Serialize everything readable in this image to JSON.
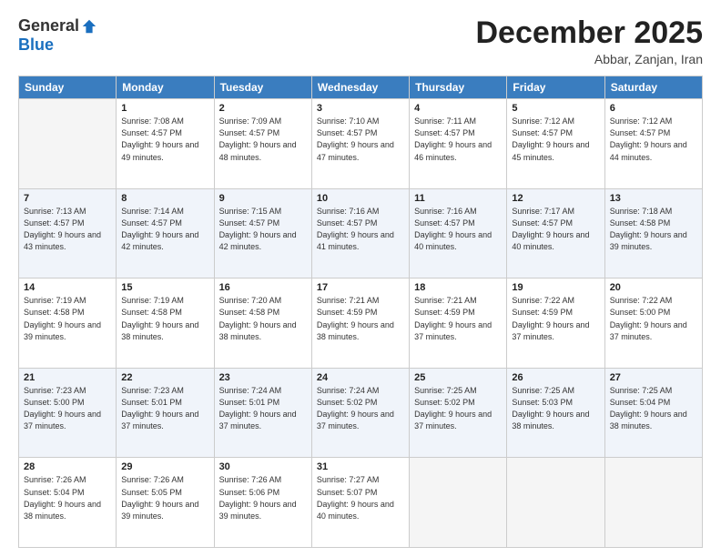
{
  "logo": {
    "general": "General",
    "blue": "Blue"
  },
  "title": "December 2025",
  "subtitle": "Abbar, Zanjan, Iran",
  "weekdays": [
    "Sunday",
    "Monday",
    "Tuesday",
    "Wednesday",
    "Thursday",
    "Friday",
    "Saturday"
  ],
  "weeks": [
    [
      {
        "day": "",
        "empty": true
      },
      {
        "day": "1",
        "sunrise": "7:08 AM",
        "sunset": "4:57 PM",
        "daylight": "9 hours and 49 minutes."
      },
      {
        "day": "2",
        "sunrise": "7:09 AM",
        "sunset": "4:57 PM",
        "daylight": "9 hours and 48 minutes."
      },
      {
        "day": "3",
        "sunrise": "7:10 AM",
        "sunset": "4:57 PM",
        "daylight": "9 hours and 47 minutes."
      },
      {
        "day": "4",
        "sunrise": "7:11 AM",
        "sunset": "4:57 PM",
        "daylight": "9 hours and 46 minutes."
      },
      {
        "day": "5",
        "sunrise": "7:12 AM",
        "sunset": "4:57 PM",
        "daylight": "9 hours and 45 minutes."
      },
      {
        "day": "6",
        "sunrise": "7:12 AM",
        "sunset": "4:57 PM",
        "daylight": "9 hours and 44 minutes."
      }
    ],
    [
      {
        "day": "7",
        "sunrise": "7:13 AM",
        "sunset": "4:57 PM",
        "daylight": "9 hours and 43 minutes."
      },
      {
        "day": "8",
        "sunrise": "7:14 AM",
        "sunset": "4:57 PM",
        "daylight": "9 hours and 42 minutes."
      },
      {
        "day": "9",
        "sunrise": "7:15 AM",
        "sunset": "4:57 PM",
        "daylight": "9 hours and 42 minutes."
      },
      {
        "day": "10",
        "sunrise": "7:16 AM",
        "sunset": "4:57 PM",
        "daylight": "9 hours and 41 minutes."
      },
      {
        "day": "11",
        "sunrise": "7:16 AM",
        "sunset": "4:57 PM",
        "daylight": "9 hours and 40 minutes."
      },
      {
        "day": "12",
        "sunrise": "7:17 AM",
        "sunset": "4:57 PM",
        "daylight": "9 hours and 40 minutes."
      },
      {
        "day": "13",
        "sunrise": "7:18 AM",
        "sunset": "4:58 PM",
        "daylight": "9 hours and 39 minutes."
      }
    ],
    [
      {
        "day": "14",
        "sunrise": "7:19 AM",
        "sunset": "4:58 PM",
        "daylight": "9 hours and 39 minutes."
      },
      {
        "day": "15",
        "sunrise": "7:19 AM",
        "sunset": "4:58 PM",
        "daylight": "9 hours and 38 minutes."
      },
      {
        "day": "16",
        "sunrise": "7:20 AM",
        "sunset": "4:58 PM",
        "daylight": "9 hours and 38 minutes."
      },
      {
        "day": "17",
        "sunrise": "7:21 AM",
        "sunset": "4:59 PM",
        "daylight": "9 hours and 38 minutes."
      },
      {
        "day": "18",
        "sunrise": "7:21 AM",
        "sunset": "4:59 PM",
        "daylight": "9 hours and 37 minutes."
      },
      {
        "day": "19",
        "sunrise": "7:22 AM",
        "sunset": "4:59 PM",
        "daylight": "9 hours and 37 minutes."
      },
      {
        "day": "20",
        "sunrise": "7:22 AM",
        "sunset": "5:00 PM",
        "daylight": "9 hours and 37 minutes."
      }
    ],
    [
      {
        "day": "21",
        "sunrise": "7:23 AM",
        "sunset": "5:00 PM",
        "daylight": "9 hours and 37 minutes."
      },
      {
        "day": "22",
        "sunrise": "7:23 AM",
        "sunset": "5:01 PM",
        "daylight": "9 hours and 37 minutes."
      },
      {
        "day": "23",
        "sunrise": "7:24 AM",
        "sunset": "5:01 PM",
        "daylight": "9 hours and 37 minutes."
      },
      {
        "day": "24",
        "sunrise": "7:24 AM",
        "sunset": "5:02 PM",
        "daylight": "9 hours and 37 minutes."
      },
      {
        "day": "25",
        "sunrise": "7:25 AM",
        "sunset": "5:02 PM",
        "daylight": "9 hours and 37 minutes."
      },
      {
        "day": "26",
        "sunrise": "7:25 AM",
        "sunset": "5:03 PM",
        "daylight": "9 hours and 38 minutes."
      },
      {
        "day": "27",
        "sunrise": "7:25 AM",
        "sunset": "5:04 PM",
        "daylight": "9 hours and 38 minutes."
      }
    ],
    [
      {
        "day": "28",
        "sunrise": "7:26 AM",
        "sunset": "5:04 PM",
        "daylight": "9 hours and 38 minutes."
      },
      {
        "day": "29",
        "sunrise": "7:26 AM",
        "sunset": "5:05 PM",
        "daylight": "9 hours and 39 minutes."
      },
      {
        "day": "30",
        "sunrise": "7:26 AM",
        "sunset": "5:06 PM",
        "daylight": "9 hours and 39 minutes."
      },
      {
        "day": "31",
        "sunrise": "7:27 AM",
        "sunset": "5:07 PM",
        "daylight": "9 hours and 40 minutes."
      },
      {
        "day": "",
        "empty": true
      },
      {
        "day": "",
        "empty": true
      },
      {
        "day": "",
        "empty": true
      }
    ]
  ],
  "labels": {
    "sunrise": "Sunrise:",
    "sunset": "Sunset:",
    "daylight": "Daylight:"
  }
}
